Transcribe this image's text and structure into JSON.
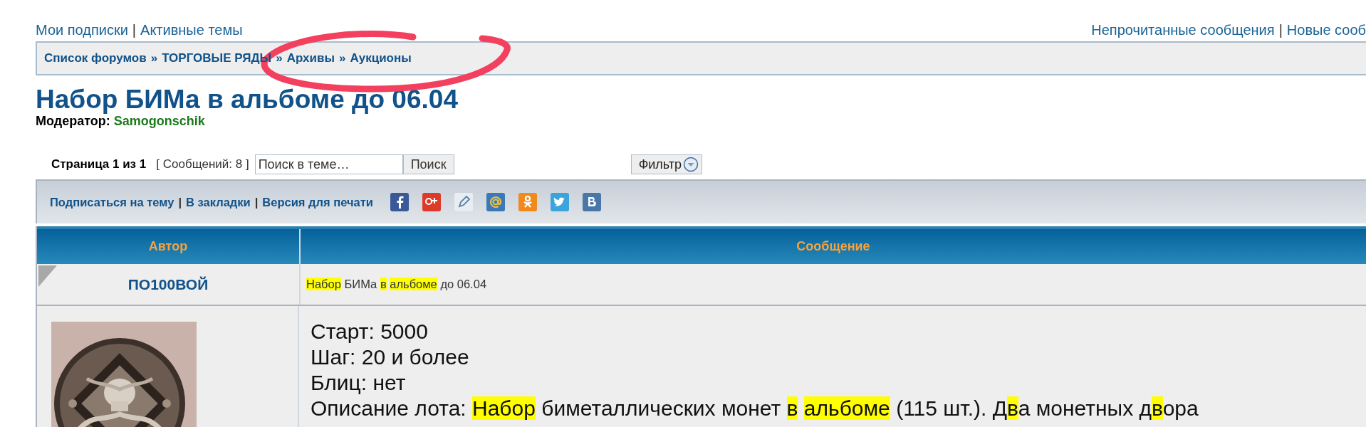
{
  "top_links": {
    "left": [
      "Мои подписки",
      "Активные темы"
    ],
    "right": [
      "Непрочитанные сообщения",
      "Новые сооб"
    ],
    "separator": "|"
  },
  "breadcrumbs": [
    "Список форумов",
    "ТОРГОВЫЕ РЯДЫ",
    "Архивы",
    "Аукционы"
  ],
  "breadcrumb_separator": "»",
  "topic": {
    "title": "Набор БИМа в альбоме до 06.04",
    "moderator_label": "Модератор:",
    "moderator": "Samogonschik"
  },
  "pagination": {
    "page": "Страница 1 из 1",
    "count": "[ Сообщений: 8 ]",
    "search": {
      "placeholder": "Поиск в теме…",
      "button": "Поиск"
    },
    "filter": "Фильтр"
  },
  "actions": [
    "Подписаться на тему",
    "В закладки",
    "Версия для печати"
  ],
  "actions_separator": "|",
  "table": {
    "columns": [
      "Автор",
      "Сообщение"
    ],
    "posts": [
      {
        "author": "ПО100ВОЙ",
        "subject": [
          {
            "text": "Набор",
            "highlighted": true
          },
          {
            "text": " БИМа ",
            "highlighted": false
          },
          {
            "text": "в",
            "highlighted": true,
            "space_after": true
          },
          {
            "text": "альбоме",
            "highlighted": true
          },
          {
            "text": " до 06.04",
            "highlighted": false
          }
        ],
        "body": [
          [
            {
              "text": "Старт: 5000",
              "highlighted": false
            }
          ],
          [
            {
              "text": "Шаг: 20 и более",
              "highlighted": false
            }
          ],
          [
            {
              "text": "Блиц: нет",
              "highlighted": false
            }
          ],
          [
            {
              "text": "Описание лота: ",
              "highlighted": false
            },
            {
              "text": "Набор",
              "highlighted": true
            },
            {
              "text": " биметаллических монет ",
              "highlighted": false
            },
            {
              "text": "в",
              "highlighted": true,
              "space_after": true
            },
            {
              "text": "альбоме",
              "highlighted": true
            },
            {
              "text": " (115 шт.). Д",
              "highlighted": false
            },
            {
              "text": "в",
              "highlighted": true
            },
            {
              "text": "а монетных д",
              "highlighted": false
            },
            {
              "text": "в",
              "highlighted": true
            },
            {
              "text": "ора",
              "highlighted": false
            }
          ]
        ]
      }
    ]
  }
}
